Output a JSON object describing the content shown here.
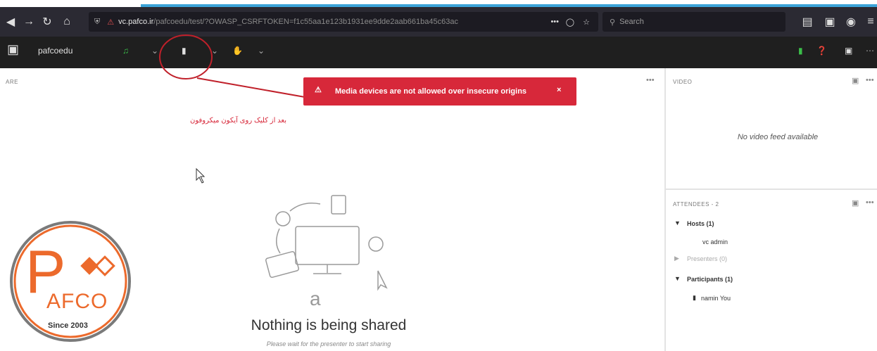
{
  "browser": {
    "url_domain": "vc.pafco.ir",
    "url_path": "/pafcoedu/test/?OWASP_CSRFTOKEN=f1c55aa1e123b1931ee9dde2aab661ba45c63ac",
    "search_placeholder": "Search",
    "page_actions": "•••"
  },
  "app": {
    "room_name": "pafcoedu"
  },
  "share_pod": {
    "label": "ARE",
    "menu": "•••",
    "empty_title": "Nothing is being shared",
    "empty_subtitle": "Please wait for the presenter to start sharing"
  },
  "toast": {
    "message": "Media devices are not allowed over insecure origins",
    "close": "×",
    "color": "#d7283a"
  },
  "annotation": {
    "farsi_note": "بعد از کلیک روی آیکون میکروفون",
    "color": "#d7283a"
  },
  "video_pod": {
    "label": "VIDEO",
    "menu": "•••",
    "empty_text": "No video feed available"
  },
  "attendees_pod": {
    "label": "ATTENDEES - 2",
    "menu": "•••",
    "groups": [
      {
        "name": "Hosts (1)",
        "expanded": true,
        "members": [
          "vc admin"
        ]
      },
      {
        "name": "Presenters (0)",
        "expanded": false,
        "members": []
      },
      {
        "name": "Participants (1)",
        "expanded": true,
        "members": [
          "namin You"
        ]
      }
    ]
  },
  "logo": {
    "letters": "AFCO",
    "big_letter": "P",
    "since": "Since 2003",
    "accent": "#ec6a2c",
    "ring": "#7a7a7a"
  }
}
